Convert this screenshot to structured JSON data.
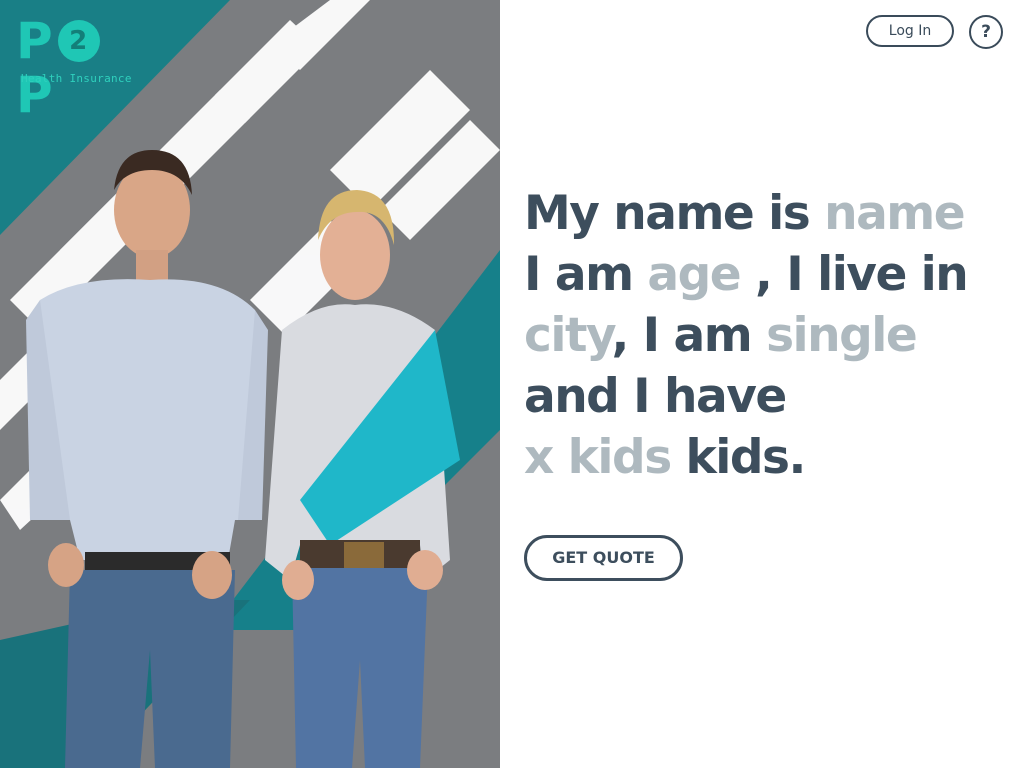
{
  "brand": {
    "logo_left": "P",
    "logo_circle": "2",
    "logo_right": "P",
    "tagline": "Health Insurance"
  },
  "header": {
    "login_label": "Log In",
    "help_label": "?"
  },
  "sentence": {
    "l1_a": "My name is ",
    "name_field": "name",
    "l2_a": "I am ",
    "age_field": "age",
    "l2_b": " , I live in",
    "city_field": "city",
    "l3_a": ", I am ",
    "status_field": "single",
    "l4_a": "and I have",
    "kids_field": "x kids",
    "l5_a": " kids."
  },
  "cta": {
    "quote_label": "GET QUOTE"
  },
  "colors": {
    "accent_teal": "#1fc7b5",
    "text_dark": "#3d4e5d",
    "placeholder": "#aeb9bf"
  }
}
